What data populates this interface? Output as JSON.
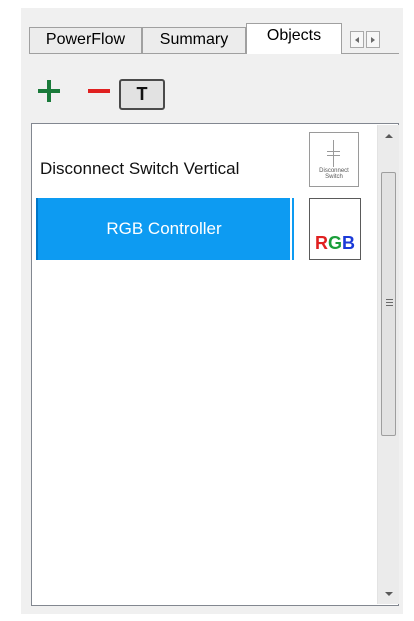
{
  "tabs": [
    {
      "label": "PowerFlow",
      "active": false
    },
    {
      "label": "Summary",
      "active": false
    },
    {
      "label": "Objects",
      "active": true
    }
  ],
  "tab_scroll": {
    "left_icon": "chevron-left-icon",
    "right_icon": "chevron-right-icon"
  },
  "toolbar": {
    "add_icon": "plus-icon",
    "remove_icon": "minus-icon",
    "text_toggle_label": "T"
  },
  "objects": [
    {
      "label": "Disconnect Switch Vertical",
      "selected": false,
      "thumbnail_caption": "Disconnect\nSwitch"
    },
    {
      "label": "RGB Controller",
      "selected": true,
      "thumbnail_letters": [
        "R",
        "G",
        "B"
      ]
    }
  ],
  "colors": {
    "selection": "#0d9bf2",
    "add": "#1a7a3a",
    "remove": "#e02020",
    "rgb_r": "#e02020",
    "rgb_g": "#1a9e3a",
    "rgb_b": "#1a3ad8"
  },
  "scrollbar": {
    "grip_icon": "grip-icon"
  }
}
